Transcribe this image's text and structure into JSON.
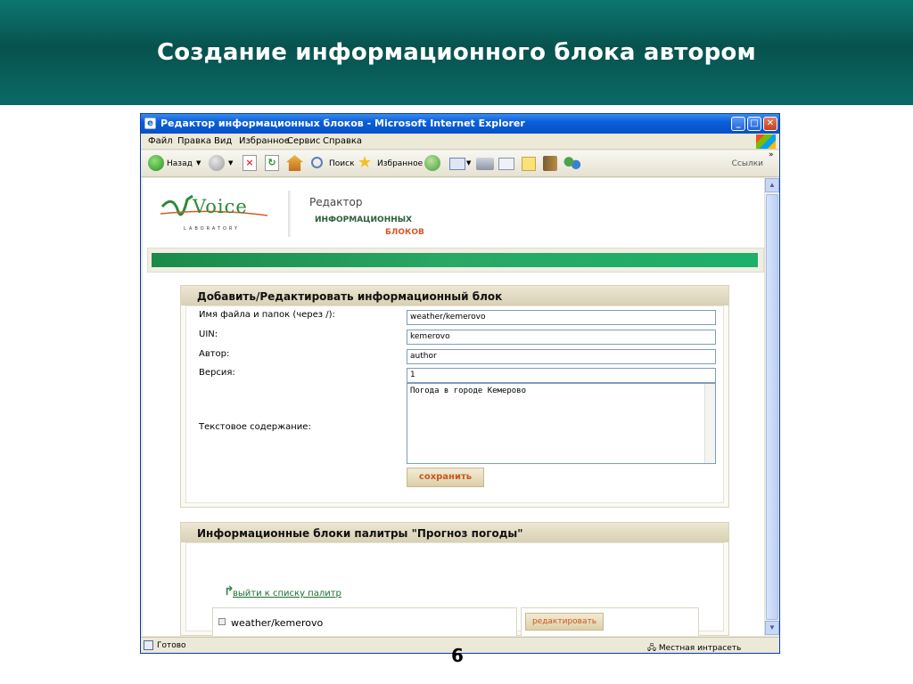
{
  "slide": {
    "title": "Создание информационного блока автором",
    "page_number": "6"
  },
  "browser": {
    "title": "Редактор информационных блоков - Microsoft Internet Explorer",
    "menu": [
      "Файл",
      "Правка",
      "Вид",
      "Избранное",
      "Сервис",
      "Справка"
    ],
    "toolbar": {
      "back": "Назад",
      "search": "Поиск",
      "favorites": "Избранное",
      "links": "Ссылки"
    },
    "status": {
      "text": "Готово",
      "zone": "Местная интрасеть"
    }
  },
  "header": {
    "logo_text": "Voice",
    "logo_sub": "LABORATORY",
    "editor_line1": "Редактор",
    "editor_line2": "ИНФОРМАЦИОННЫХ",
    "editor_line3": "БЛОКОВ"
  },
  "form": {
    "title": "Добавить/Редактировать информационный блок",
    "fields": [
      {
        "label": "Имя файла и папок (через /):",
        "value": "weather/kemerovo"
      },
      {
        "label": "UIN:",
        "value": "kemerovo"
      },
      {
        "label": "Автор:",
        "value": "author"
      },
      {
        "label": "Версия:",
        "value": "1"
      }
    ],
    "content_label": "Текстовое содержание:",
    "content_value": "Погода в городе Кемерово",
    "save_label": "сохранить"
  },
  "palette": {
    "title": "Информационные блоки палитры \"Прогноз погоды\"",
    "back_link": "выйти к списку палитр",
    "items": [
      {
        "name": "weather/kemerovo",
        "action": "редактировать"
      }
    ]
  },
  "colors": {
    "banner": "#07524e",
    "accent_green": "#1a8a4a",
    "button_text": "#c9561f"
  }
}
